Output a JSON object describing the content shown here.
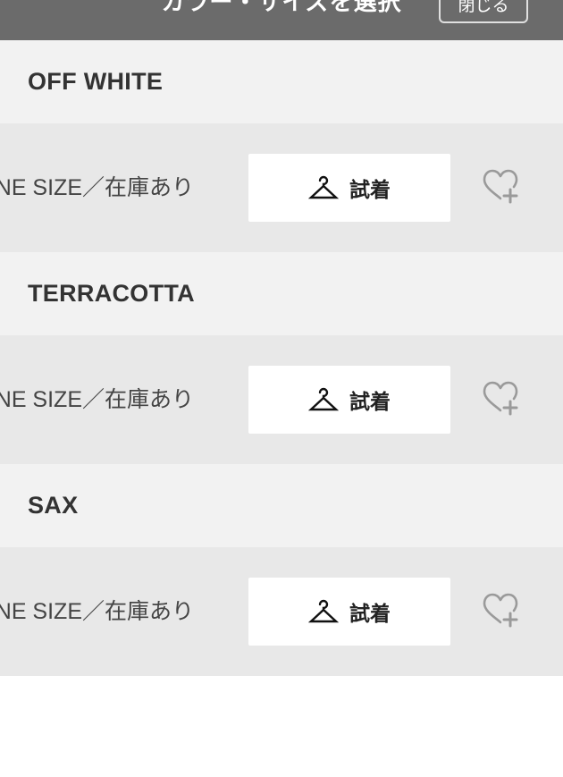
{
  "header": {
    "title": "カラー・サイズを選択",
    "close_label": "閉じる"
  },
  "colors": [
    {
      "name": "OFF WHITE",
      "size_label": "ONE SIZE／在庫あり",
      "tryon_label": "試着"
    },
    {
      "name": "TERRACOTTA",
      "size_label": "ONE SIZE／在庫あり",
      "tryon_label": "試着"
    },
    {
      "name": "SAX",
      "size_label": "ONE SIZE／在庫あり",
      "tryon_label": "試着"
    }
  ],
  "icons": {
    "tryon": "hanger-icon",
    "favorite": "heart-plus-icon"
  },
  "colors_theme": {
    "header_bg": "#6b6b6b",
    "color_header_bg": "#f2f2f2",
    "size_row_bg": "#e8e8e8",
    "button_bg": "#ffffff"
  }
}
